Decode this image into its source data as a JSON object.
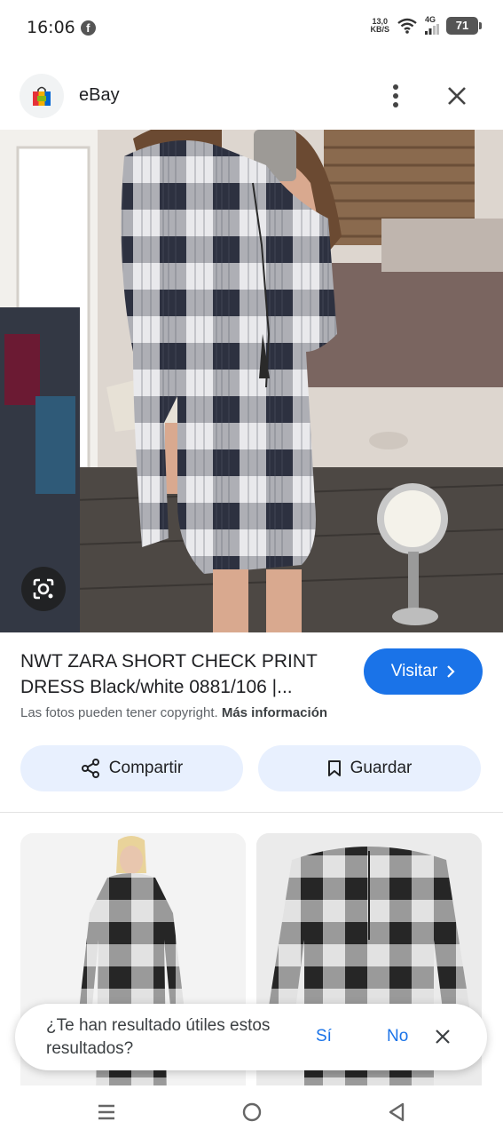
{
  "status_bar": {
    "time": "16:06",
    "net_speed_value": "13,0",
    "net_speed_unit": "KB/S",
    "network_type": "4G",
    "battery": "71"
  },
  "header": {
    "site_name": "eBay"
  },
  "result": {
    "title": "NWT ZARA SHORT CHECK PRINT DRESS Black/white 0881/106 |...",
    "visit_label": "Visitar",
    "copyright_text": "Las fotos pueden tener copyright.",
    "more_info_label": "Más información",
    "share_label": "Compartir",
    "save_label": "Guardar"
  },
  "feedback": {
    "question": "¿Te han resultado útiles estos resultados?",
    "yes_label": "Sí",
    "no_label": "No"
  },
  "colors": {
    "accent": "#1a73e8",
    "chip_bg": "#e8f0fe"
  }
}
